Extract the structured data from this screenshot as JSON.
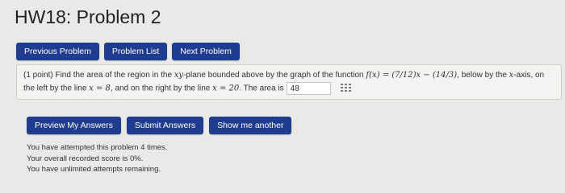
{
  "page": {
    "title": "HW18: Problem 2"
  },
  "nav": {
    "previous": "Previous Problem",
    "list": "Problem List",
    "next": "Next Problem"
  },
  "problem": {
    "line1_prefix": "(1 point) Find the area of the region in the ",
    "xy": "xy",
    "line1_mid": "-plane bounded above by the graph of the function ",
    "function": "f(x) = (7/12)x − (14/3)",
    "line1_mid2": ", below by the ",
    "x_axis_var": "x",
    "line1_suffix": "-axis, on",
    "line2_prefix": "the left by the line ",
    "left_line": "x = 8",
    "line2_mid": ", and on the right by the line ",
    "right_line": "x = 20",
    "line2_suffix": ". The area is",
    "answer_value": "48",
    "answer_icon": "grid-icon"
  },
  "actions": {
    "preview": "Preview My Answers",
    "submit": "Submit Answers",
    "show_another": "Show me another"
  },
  "status": {
    "attempts": "You have attempted this problem 4 times.",
    "score": "Your overall recorded score is 0%.",
    "remaining": "You have unlimited attempts remaining."
  },
  "colors": {
    "button": "#1f3c8f",
    "background": "#e9e9e7"
  }
}
